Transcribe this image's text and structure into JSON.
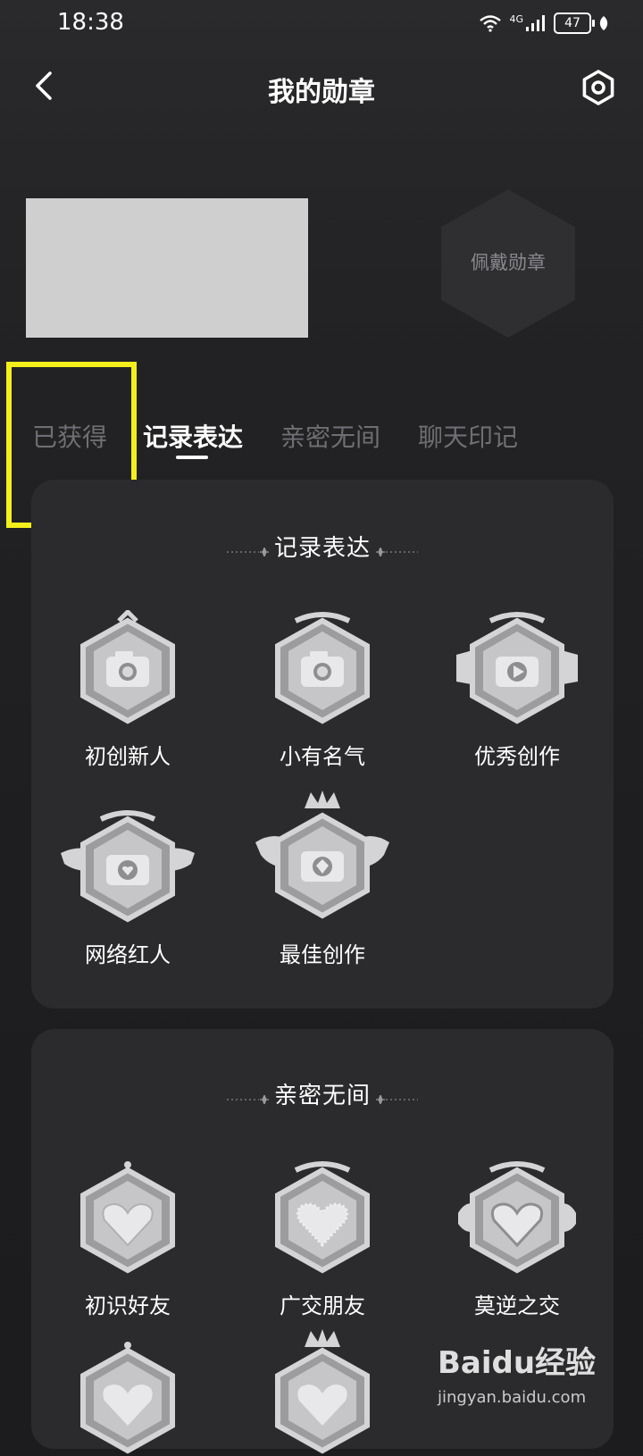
{
  "status_bar": {
    "time": "18:38",
    "network": "4G",
    "battery": "47"
  },
  "header": {
    "title": "我的勋章"
  },
  "profile": {
    "wear_badge_label": "佩戴勋章"
  },
  "tabs": [
    {
      "label": "已获得"
    },
    {
      "label": "记录表达"
    },
    {
      "label": "亲密无间"
    },
    {
      "label": "聊天印记"
    }
  ],
  "sections": [
    {
      "title": "记录表达",
      "badges": [
        {
          "label": "初创新人"
        },
        {
          "label": "小有名气"
        },
        {
          "label": "优秀创作"
        },
        {
          "label": "网络红人"
        },
        {
          "label": "最佳创作"
        }
      ]
    },
    {
      "title": "亲密无间",
      "badges": [
        {
          "label": "初识好友"
        },
        {
          "label": "广交朋友"
        },
        {
          "label": "莫逆之交"
        }
      ]
    }
  ],
  "watermark": {
    "brand": "Baidu经验",
    "url": "jingyan.baidu.com"
  },
  "colors": {
    "background": "#1c1c1e",
    "card": "#2b2b2e",
    "highlight": "#f3ef1a",
    "inactive_tab": "#6f6f73"
  }
}
